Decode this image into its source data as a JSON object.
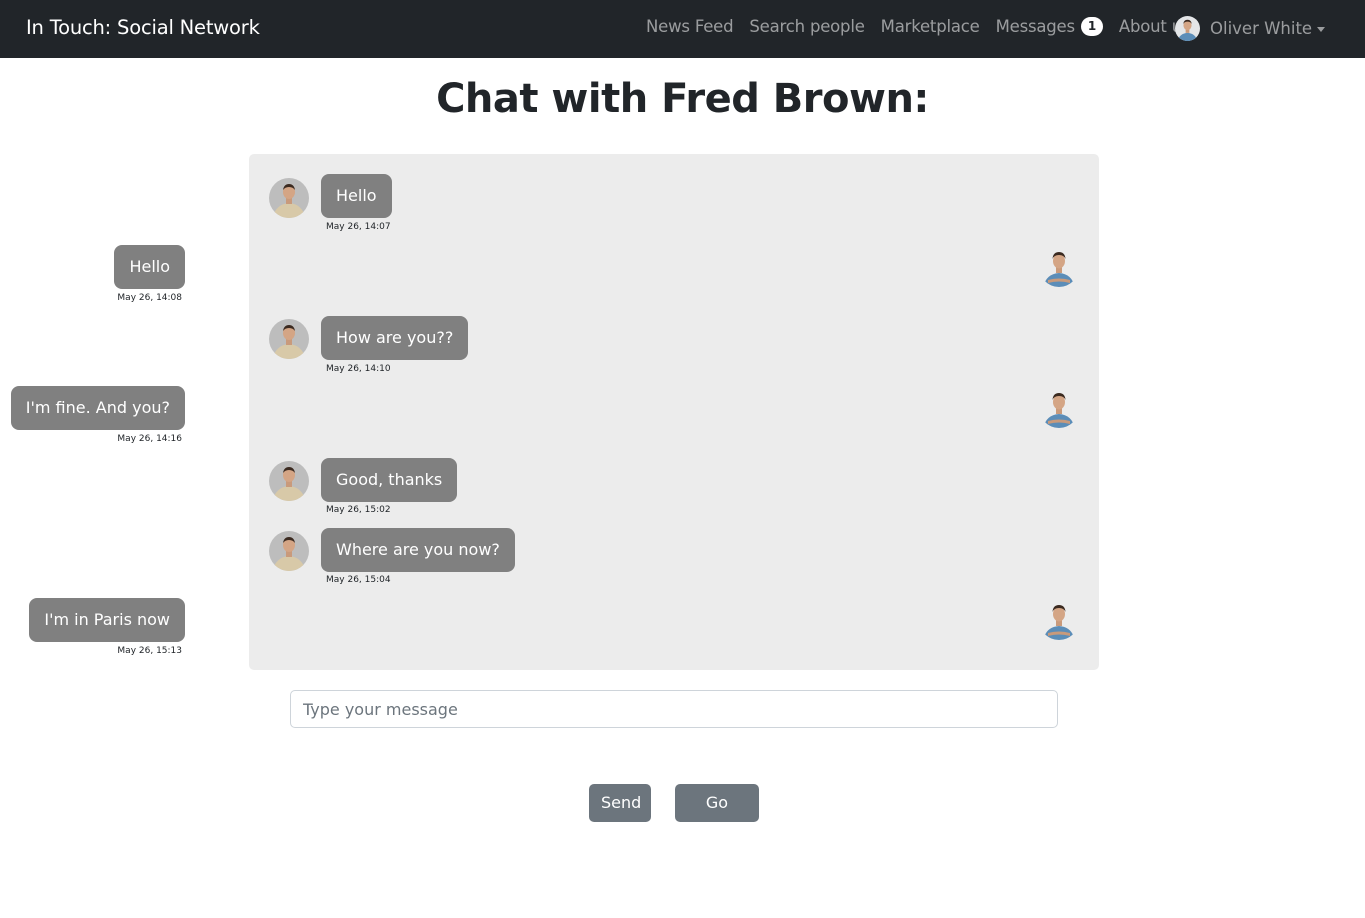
{
  "navbar": {
    "brand": "In Touch: Social Network",
    "links": [
      "News Feed",
      "Search people",
      "Marketplace",
      "Messages",
      "About us"
    ],
    "messages_badge": "1",
    "user_name": "Oliver White"
  },
  "page_title": "Chat with Fred Brown:",
  "messages": [
    {
      "sender": "Fred Brown",
      "text": "Hello",
      "time": "May 26, 14:07"
    },
    {
      "sender": "Oliver White",
      "text": "Hello",
      "time": "May 26, 14:08"
    },
    {
      "sender": "Fred Brown",
      "text": "How are you??",
      "time": "May 26, 14:10"
    },
    {
      "sender": "Oliver White",
      "text": "I'm fine. And you?",
      "time": "May 26, 14:16"
    },
    {
      "sender": "Fred Brown",
      "text": "Good, thanks",
      "time": "May 26, 15:02"
    },
    {
      "sender": "Fred Brown",
      "text": "Where are you now?",
      "time": "May 26, 15:04"
    },
    {
      "sender": "Oliver White",
      "text": "I'm in Paris now",
      "time": "May 26, 15:13"
    }
  ],
  "input": {
    "placeholder": "Type your message",
    "value": ""
  },
  "buttons": {
    "send": "Send",
    "back": "Go Back"
  },
  "colors": {
    "navbar_bg": "#212529",
    "chat_bg": "#ececec",
    "bubble_bg": "#808080",
    "button_bg": "#6c757d"
  }
}
